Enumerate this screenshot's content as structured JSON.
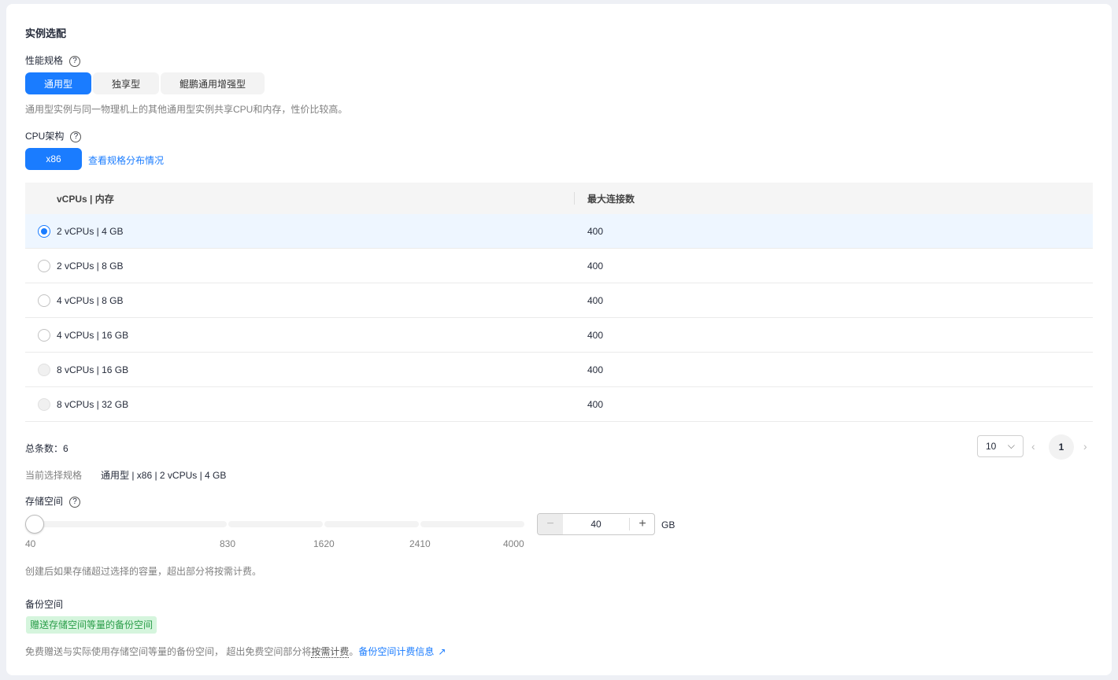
{
  "section_title": "实例选配",
  "perf": {
    "label": "性能规格",
    "options": [
      "通用型",
      "独享型",
      "鲲鹏通用增强型"
    ],
    "selected": 0,
    "desc": "通用型实例与同一物理机上的其他通用型实例共享CPU和内存，性价比较高。"
  },
  "cpu": {
    "label": "CPU架构",
    "options": [
      "x86"
    ],
    "link": "查看规格分布情况"
  },
  "table": {
    "headers": [
      "vCPUs | 内存",
      "最大连接数"
    ],
    "rows": [
      {
        "spec": "2 vCPUs | 4 GB",
        "conn": "400",
        "state": "selected"
      },
      {
        "spec": "2 vCPUs | 8 GB",
        "conn": "400",
        "state": "normal"
      },
      {
        "spec": "4 vCPUs | 8 GB",
        "conn": "400",
        "state": "normal"
      },
      {
        "spec": "4 vCPUs | 16 GB",
        "conn": "400",
        "state": "normal"
      },
      {
        "spec": "8 vCPUs | 16 GB",
        "conn": "400",
        "state": "disabled"
      },
      {
        "spec": "8 vCPUs | 32 GB",
        "conn": "400",
        "state": "disabled"
      }
    ]
  },
  "pagination": {
    "total_label": "总条数：6",
    "page_size": "10",
    "current_page": "1"
  },
  "current": {
    "label": "当前选择规格",
    "value": "通用型 | x86 | 2 vCPUs | 4 GB"
  },
  "storage": {
    "label": "存储空间",
    "ticks": [
      "40",
      "830",
      "1620",
      "2410",
      "4000"
    ],
    "value": "40",
    "unit": "GB",
    "desc": "创建后如果存储超过选择的容量，超出部分将按需计费。"
  },
  "backup": {
    "label": "备份空间",
    "tag": "赠送存储空间等量的备份空间",
    "desc_prefix": "免费赠送与实际使用存储空间等量的备份空间， 超出免费空间部分将",
    "desc_term": "按需计费",
    "desc_suffix": "。",
    "link": "备份空间计费信息"
  },
  "colors": {
    "primary": "#1a7cff",
    "tag_bg": "#d5f5dd",
    "tag_text": "#2a9d49"
  }
}
